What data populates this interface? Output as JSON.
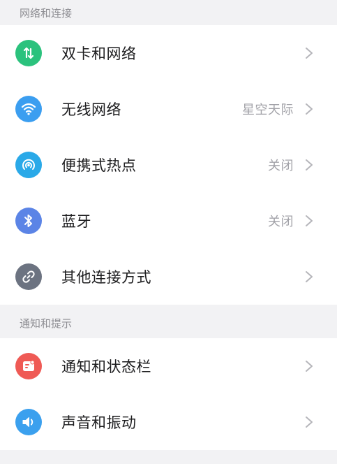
{
  "sections": [
    {
      "header": "网络和连接",
      "items": [
        {
          "label": "双卡和网络",
          "value": "",
          "icon": "dual-sim-icon",
          "color": "#2bc27d"
        },
        {
          "label": "无线网络",
          "value": "星空天际",
          "icon": "wifi-icon",
          "color": "#3b9ef0"
        },
        {
          "label": "便携式热点",
          "value": "关闭",
          "icon": "hotspot-icon",
          "color": "#2aa9e8"
        },
        {
          "label": "蓝牙",
          "value": "关闭",
          "icon": "bluetooth-icon",
          "color": "#5b84e6"
        },
        {
          "label": "其他连接方式",
          "value": "",
          "icon": "link-icon",
          "color": "#6c7381"
        }
      ]
    },
    {
      "header": "通知和提示",
      "items": [
        {
          "label": "通知和状态栏",
          "value": "",
          "icon": "notification-icon",
          "color": "#ef5a55"
        },
        {
          "label": "声音和振动",
          "value": "",
          "icon": "sound-icon",
          "color": "#3ba0ee"
        }
      ]
    }
  ]
}
